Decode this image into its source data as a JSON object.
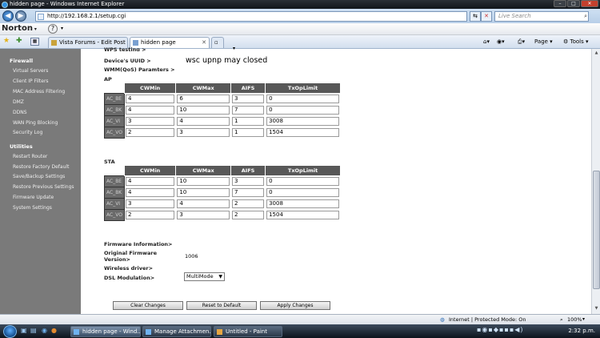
{
  "window": {
    "title": "hidden page - Windows Internet Explorer"
  },
  "address": {
    "url": "http://192.168.2.1/setup.cgi"
  },
  "search": {
    "placeholder": "Live Search"
  },
  "norton": {
    "label": "Norton"
  },
  "tabs": [
    {
      "label": "Vista Forums - Edit Post"
    },
    {
      "label": "hidden page"
    }
  ],
  "commands": {
    "page": "Page",
    "tools": "Tools"
  },
  "sidebar": {
    "firewall_heading": "Firewall",
    "firewall_items": [
      "Virtual Servers",
      "Client IP Filters",
      "MAC Address Filtering",
      "DMZ",
      "DDNS",
      "WAN Ping Blocking",
      "Security Log"
    ],
    "utilities_heading": "Utilities",
    "utilities_items": [
      "Restart Router",
      "Restore Factory Default",
      "Save/Backup Settings",
      "Restore Previous Settings",
      "Firmware Update",
      "System Settings"
    ]
  },
  "content": {
    "wps_label": "WPS testing >",
    "uuid_label": "Device's UUID >",
    "uuid_value": "wsc upnp may closed",
    "wmm_label": "WMM(QoS) Paramters >",
    "ap_label": "AP",
    "sta_label": "STA",
    "columns": [
      "CWMin",
      "CWMax",
      "AIFS",
      "TxOpLimit"
    ],
    "ap_rows": [
      {
        "label": "AC_BE",
        "cwmin": "4",
        "cwmax": "6",
        "aifs": "3",
        "txop": "0"
      },
      {
        "label": "AC_BK",
        "cwmin": "4",
        "cwmax": "10",
        "aifs": "7",
        "txop": "0"
      },
      {
        "label": "AC_VI",
        "cwmin": "3",
        "cwmax": "4",
        "aifs": "1",
        "txop": "3008"
      },
      {
        "label": "AC_VO",
        "cwmin": "2",
        "cwmax": "3",
        "aifs": "1",
        "txop": "1504"
      }
    ],
    "sta_rows": [
      {
        "label": "AC_BE",
        "cwmin": "4",
        "cwmax": "10",
        "aifs": "3",
        "txop": "0"
      },
      {
        "label": "AC_BK",
        "cwmin": "4",
        "cwmax": "10",
        "aifs": "7",
        "txop": "0"
      },
      {
        "label": "AC_VI",
        "cwmin": "3",
        "cwmax": "4",
        "aifs": "2",
        "txop": "3008"
      },
      {
        "label": "AC_VO",
        "cwmin": "2",
        "cwmax": "3",
        "aifs": "2",
        "txop": "1504"
      }
    ],
    "firmware_info_label": "Firmware Information>",
    "orig_fw_label_1": "Original Firmware",
    "orig_fw_label_2": "Version>",
    "orig_fw_value": "1006",
    "wireless_driver_label": "Wireless driver>",
    "dsl_label": "DSL Modulation>",
    "dsl_value": "MultiMode",
    "buttons": {
      "clear": "Clear Changes",
      "reset": "Reset to Default",
      "apply": "Apply Changes"
    }
  },
  "status": {
    "zone": "Internet | Protected Mode: On",
    "zoom": "100%"
  },
  "taskbar": {
    "items": [
      "hidden page - Wind...",
      "Manage Attachmen...",
      "Untitled - Paint"
    ],
    "clock": "2:32 p.m."
  }
}
